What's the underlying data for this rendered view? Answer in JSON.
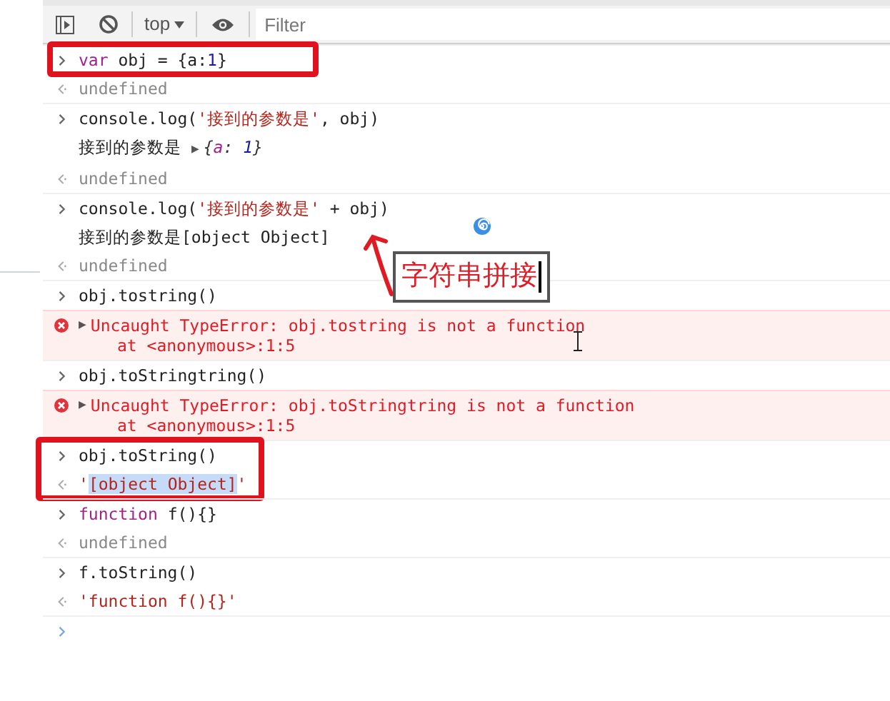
{
  "toolbar": {
    "context": "top",
    "filter_placeholder": "Filter"
  },
  "entries": [
    {
      "kind": "input",
      "boxed": true,
      "tokens": [
        {
          "kind": "keyword",
          "text": "var"
        },
        {
          "kind": "plain",
          "text": " obj = {a:"
        },
        {
          "kind": "number",
          "text": "1"
        },
        {
          "kind": "plain",
          "text": "}"
        }
      ]
    },
    {
      "kind": "result",
      "tokens": [
        {
          "kind": "undefined",
          "text": "undefined"
        }
      ]
    },
    {
      "kind": "input",
      "tokens": [
        {
          "kind": "plain",
          "text": "console.log("
        },
        {
          "kind": "string",
          "text": "'接到的参数是'"
        },
        {
          "kind": "plain",
          "text": ", obj)"
        }
      ]
    },
    {
      "kind": "log",
      "tokens": [
        {
          "kind": "plain",
          "text": "接到的参数是 "
        },
        {
          "kind": "expander",
          "text": "▶"
        },
        {
          "kind": "preview",
          "text": "{"
        },
        {
          "kind": "preview_key",
          "text": "a"
        },
        {
          "kind": "preview",
          "text": ": "
        },
        {
          "kind": "preview_number",
          "text": "1"
        },
        {
          "kind": "preview",
          "text": "}"
        }
      ]
    },
    {
      "kind": "result",
      "tokens": [
        {
          "kind": "undefined",
          "text": "undefined"
        }
      ]
    },
    {
      "kind": "input",
      "tokens": [
        {
          "kind": "plain",
          "text": "console.log("
        },
        {
          "kind": "string",
          "text": "'接到的参数是'"
        },
        {
          "kind": "plain",
          "text": " + obj)"
        }
      ]
    },
    {
      "kind": "log",
      "tokens": [
        {
          "kind": "plain",
          "text": "接到的参数是[object Object]"
        }
      ]
    },
    {
      "kind": "result",
      "tokens": [
        {
          "kind": "undefined",
          "text": "undefined"
        }
      ]
    },
    {
      "kind": "input",
      "tokens": [
        {
          "kind": "plain",
          "text": "obj.tostring()"
        }
      ]
    },
    {
      "kind": "error",
      "expander": "▶",
      "message": "Uncaught TypeError: obj.tostring is not a function",
      "stack": "at <anonymous>:1:5"
    },
    {
      "kind": "input",
      "tokens": [
        {
          "kind": "plain",
          "text": "obj.toStringtring()"
        }
      ]
    },
    {
      "kind": "error",
      "expander": "▶",
      "message": "Uncaught TypeError: obj.toStringtring is not a function",
      "stack": "at <anonymous>:1:5"
    },
    {
      "kind": "input",
      "boxed": true,
      "tokens": [
        {
          "kind": "plain",
          "text": "obj.toString()"
        }
      ]
    },
    {
      "kind": "result",
      "boxed": true,
      "tokens": [
        {
          "kind": "string",
          "text": "'"
        },
        {
          "kind": "selected_string",
          "text": "[object Object]"
        },
        {
          "kind": "string",
          "text": "'"
        }
      ]
    },
    {
      "kind": "input",
      "tokens": [
        {
          "kind": "keyword",
          "text": "function"
        },
        {
          "kind": "plain",
          "text": " f(){}"
        }
      ]
    },
    {
      "kind": "result",
      "tokens": [
        {
          "kind": "undefined",
          "text": "undefined"
        }
      ]
    },
    {
      "kind": "input",
      "tokens": [
        {
          "kind": "plain",
          "text": "f.toString()"
        }
      ]
    },
    {
      "kind": "result",
      "tokens": [
        {
          "kind": "string",
          "text": "'function f(){}'"
        }
      ]
    },
    {
      "kind": "prompt"
    }
  ],
  "callout": {
    "text": "字符串拼接"
  }
}
